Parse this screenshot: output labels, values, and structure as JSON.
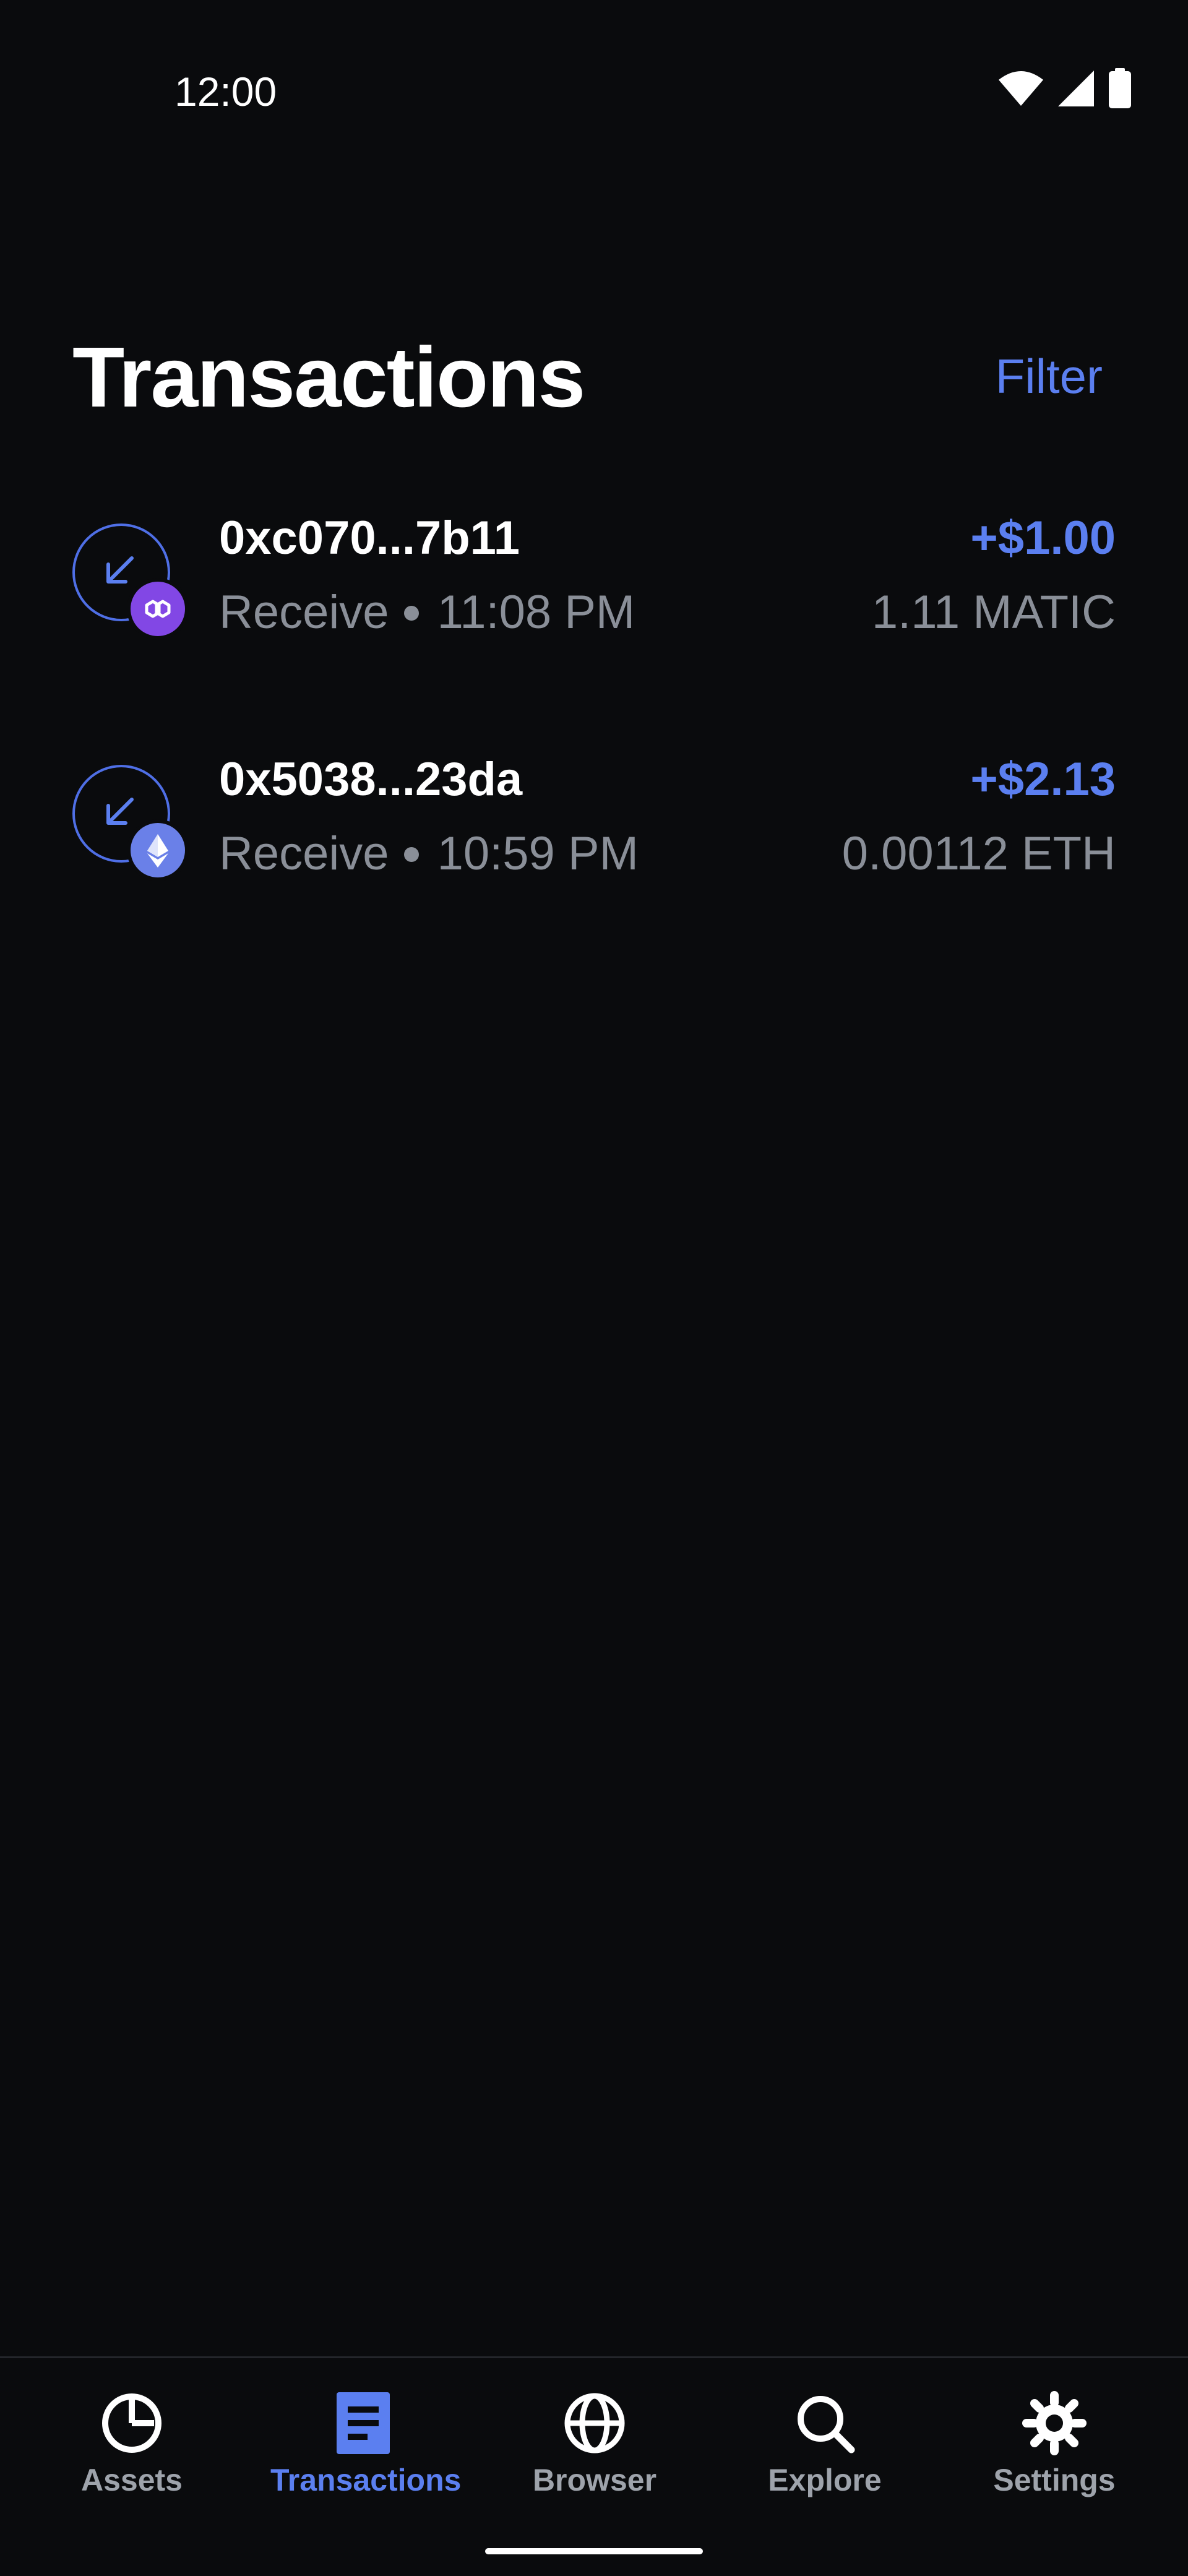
{
  "status_bar": {
    "time": "12:00",
    "icons": [
      "wifi-icon",
      "cell-signal-icon",
      "battery-icon"
    ]
  },
  "header": {
    "title": "Transactions",
    "filter_label": "Filter"
  },
  "transactions": [
    {
      "address": "0xc070...7b11",
      "type": "Receive",
      "time": "11:08 PM",
      "amount_usd": "+$1.00",
      "amount_token": "1.11 MATIC",
      "token_icon": "polygon-icon"
    },
    {
      "address": "0x5038...23da",
      "type": "Receive",
      "time": "10:59 PM",
      "amount_usd": "+$2.13",
      "amount_token": "0.00112 ETH",
      "token_icon": "ethereum-icon"
    }
  ],
  "nav": {
    "items": [
      {
        "label": "Assets",
        "icon": "pie-chart-icon",
        "active": false
      },
      {
        "label": "Transactions",
        "icon": "document-icon",
        "active": true
      },
      {
        "label": "Browser",
        "icon": "globe-icon",
        "active": false
      },
      {
        "label": "Explore",
        "icon": "search-icon",
        "active": false
      },
      {
        "label": "Settings",
        "icon": "gear-icon",
        "active": false
      }
    ]
  },
  "colors": {
    "background": "#0a0b0d",
    "accent": "#5b7ff0",
    "muted_text": "#8a8f98",
    "matic": "#8247e5",
    "eth": "#6a80e8"
  }
}
